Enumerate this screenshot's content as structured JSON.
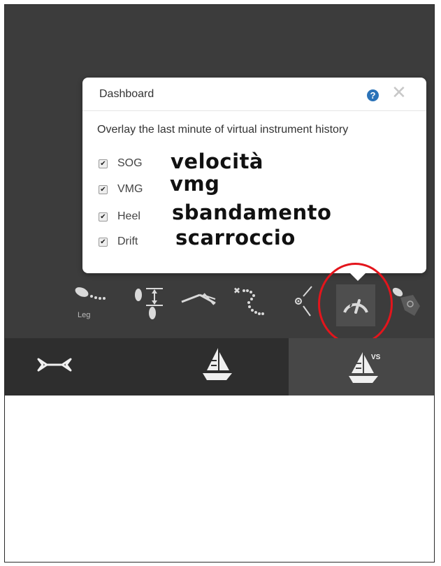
{
  "dialog": {
    "title": "Dashboard",
    "help_symbol": "?",
    "close_symbol": "✕",
    "description": "Overlay the last minute of virtual instrument history",
    "options": [
      {
        "label": "SOG",
        "checked": true,
        "annotation": "velocità"
      },
      {
        "label": "VMG",
        "checked": true,
        "annotation": "vmg"
      },
      {
        "label": "Heel",
        "checked": true,
        "annotation": "sbandamento"
      },
      {
        "label": "Drift",
        "checked": true,
        "annotation": "scarroccio"
      }
    ]
  },
  "toolbar": {
    "leg_label": "Leg",
    "icons": [
      "leg-icon",
      "draft-measure-icon",
      "ruler-icon",
      "route-dots-icon",
      "angle-icon",
      "dashboard-gauge-icon",
      "map-pin-icon"
    ],
    "active": "dashboard-gauge-icon"
  },
  "tabs": [
    {
      "icon": "crossed-flags-icon",
      "active": false
    },
    {
      "icon": "sailboat-icon",
      "active": false
    },
    {
      "icon": "sailboat-vs-icon",
      "label": "VS",
      "active": true
    }
  ],
  "colors": {
    "background": "#3c3c3c",
    "highlight": "#e3151c",
    "help_icon": "#2b73b8",
    "icon": "#d9d9d9"
  }
}
